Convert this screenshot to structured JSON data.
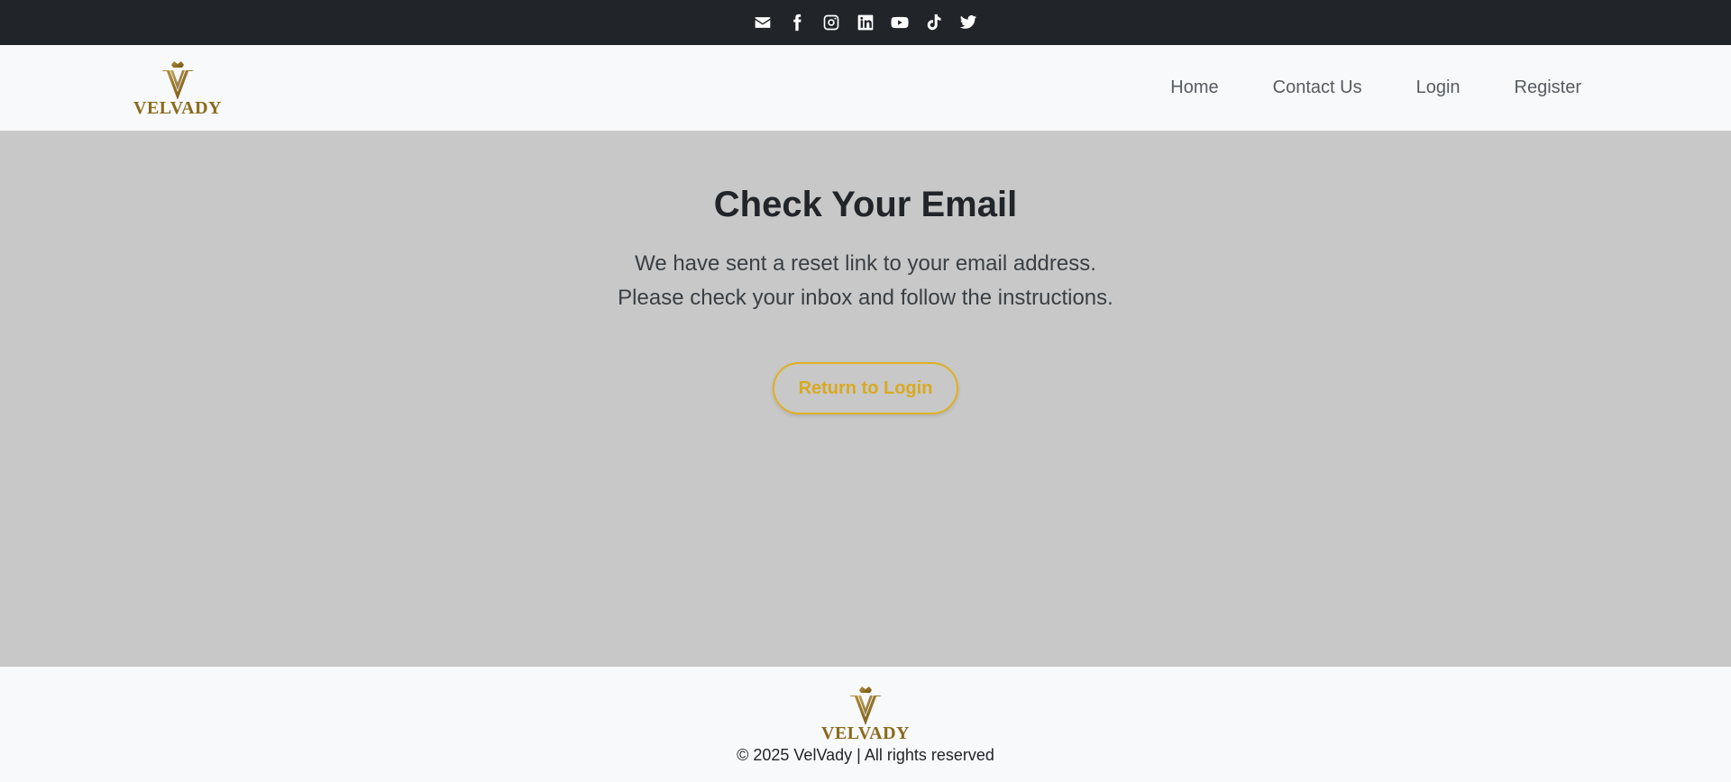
{
  "topbar": {
    "icons": [
      "envelope-icon",
      "facebook-icon",
      "instagram-icon",
      "linkedin-icon",
      "youtube-icon",
      "tiktok-icon",
      "twitter-icon"
    ]
  },
  "brand": {
    "name": "VELVADY",
    "gold": "#8a6a1e"
  },
  "nav": {
    "items": [
      {
        "label": "Home"
      },
      {
        "label": "Contact Us"
      },
      {
        "label": "Login"
      },
      {
        "label": "Register"
      }
    ]
  },
  "main": {
    "title": "Check Your Email",
    "line1": "We have sent a reset link to your email address.",
    "line2": "Please check your inbox and follow the instructions.",
    "button_label": "Return to Login",
    "accent": "#e0b020"
  },
  "footer": {
    "brand": "VELVADY",
    "copyright": "© 2025 VelVady | All rights reserved"
  }
}
